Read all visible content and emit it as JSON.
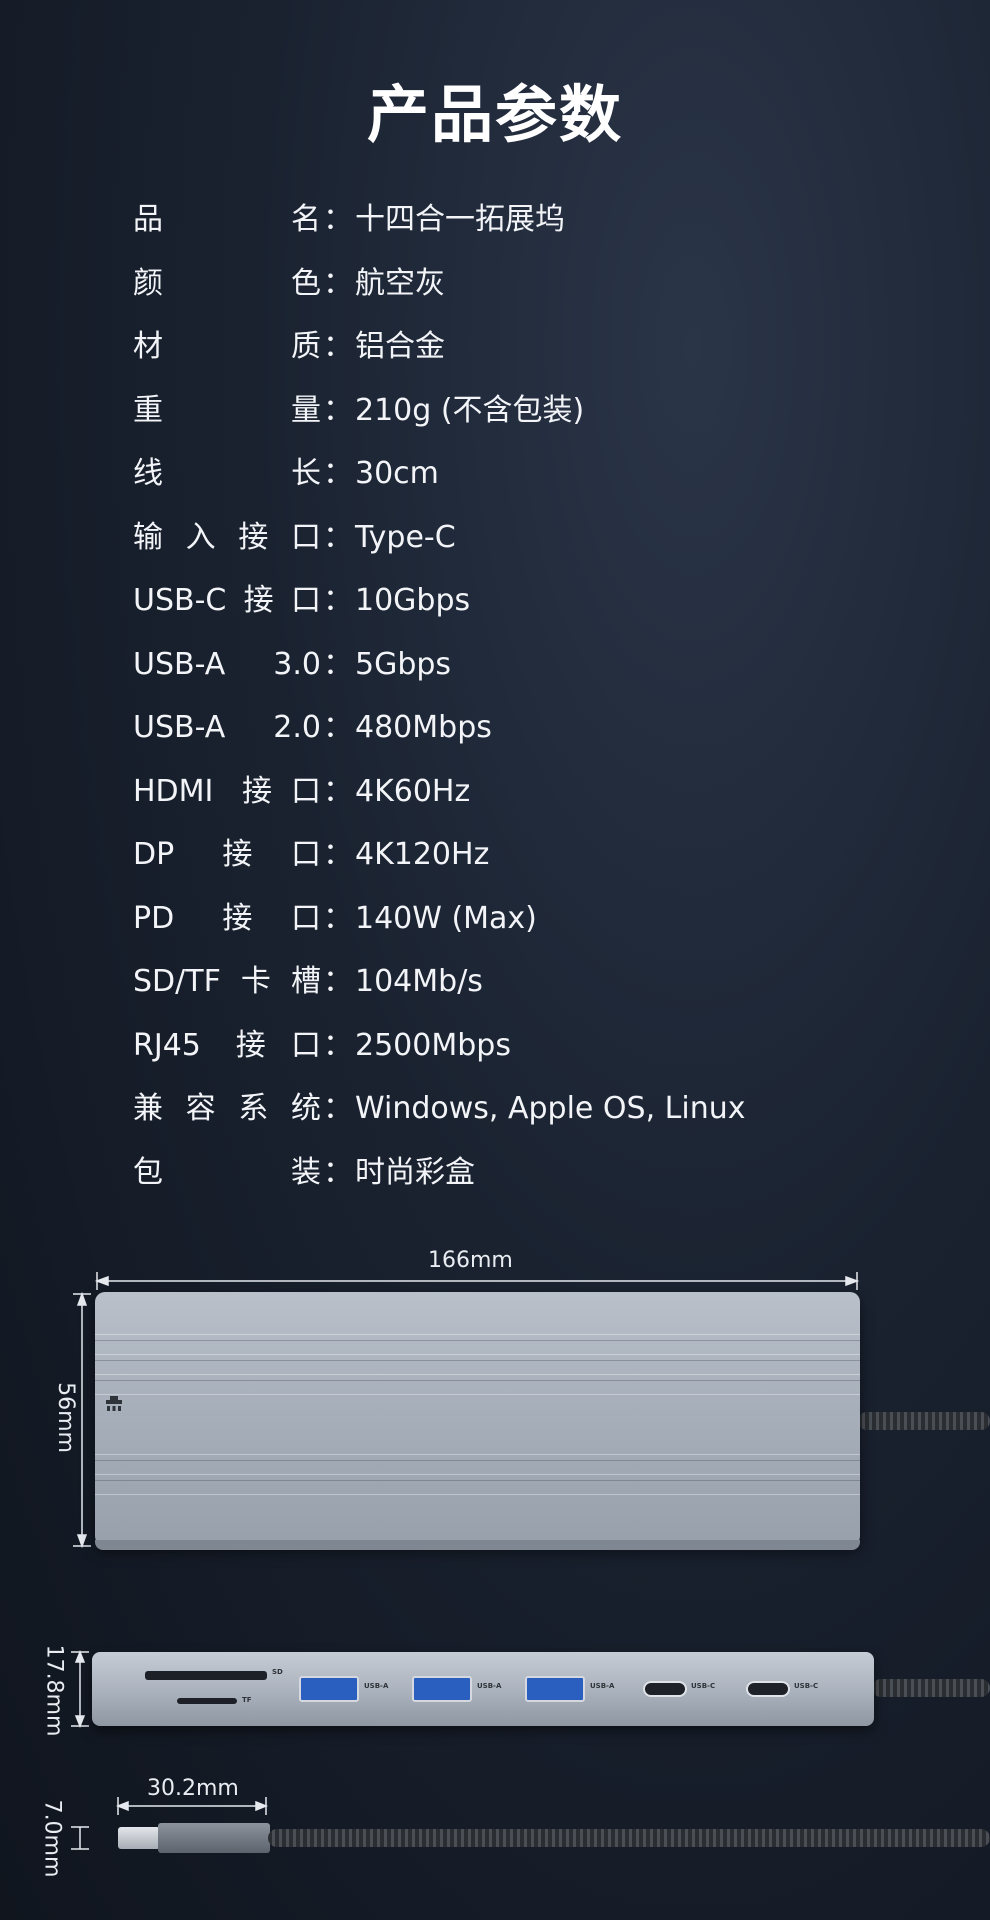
{
  "title": "产品参数",
  "specs": [
    {
      "label": "品名",
      "value": "十四合一拓展坞"
    },
    {
      "label": "颜色",
      "value": "航空灰"
    },
    {
      "label": "材质",
      "value": "铝合金"
    },
    {
      "label": "重量",
      "value": "210g (不含包装)"
    },
    {
      "label": "线长",
      "value": "30cm"
    },
    {
      "label": "输入接口",
      "value": "Type-C"
    },
    {
      "label": "USB-C接口",
      "value": "10Gbps"
    },
    {
      "label": "USB-A 3.0",
      "value": "5Gbps"
    },
    {
      "label": "USB-A 2.0",
      "value": "480Mbps"
    },
    {
      "label": "HDMI 接口",
      "value": "4K60Hz"
    },
    {
      "label": "DP 接口",
      "value": "4K120Hz"
    },
    {
      "label": "PD 接口",
      "value": "140W (Max)"
    },
    {
      "label": "SD/TF卡槽",
      "value": "104Mb/s"
    },
    {
      "label": "RJ45 接口",
      "value": "2500Mbps"
    },
    {
      "label": "兼容系统",
      "value": "Windows, Apple OS,  Linux"
    },
    {
      "label": "包装",
      "value": "时尚彩盒"
    }
  ],
  "separator": "：",
  "dimensions": {
    "length": "166mm",
    "width": "56mm",
    "height": "17.8mm",
    "plug_length": "30.2mm",
    "plug_height": "7.0mm"
  },
  "port_labels": {
    "sd": "SD",
    "tf": "TF",
    "usb_a": "USB-A",
    "usb_c": "USB-C"
  }
}
